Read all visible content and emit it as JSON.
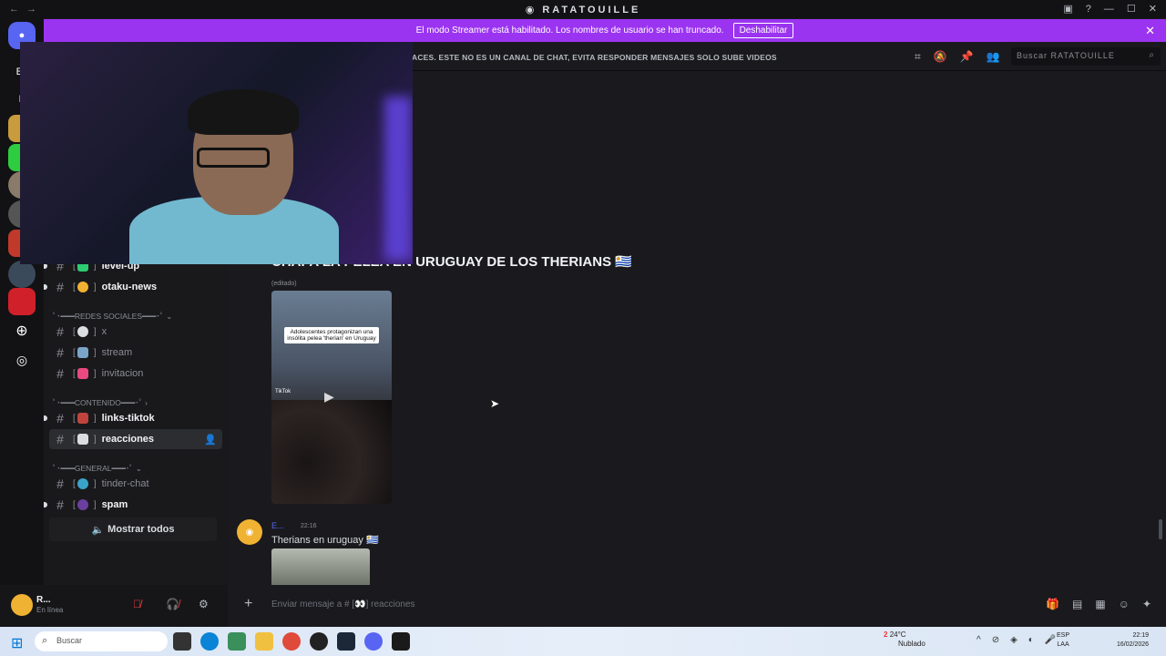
{
  "titlebar": {
    "back": "←",
    "forward": "→",
    "title": "RATATOUILLE"
  },
  "banner": {
    "text": "El modo Streamer está habilitado. Los nombres de usuario se han truncado.",
    "button": "Deshabilitar",
    "close": "✕"
  },
  "rail": {
    "server_initials": [
      "Es",
      "F"
    ]
  },
  "topbar": {
    "topic": "ACES. ESTE NO ES UN CANAL DE CHAT, EVITA RESPONDER MENSAJES SOLO SUBE VIDEOS",
    "search_placeholder": "Buscar RATATOUILLE"
  },
  "sidebar": {
    "channels": [
      {
        "name": "level-up",
        "bracket_open": "[",
        "bracket_close": "]"
      },
      {
        "name": "otaku-news",
        "bracket_open": "[",
        "bracket_close": "]"
      },
      {
        "name": "x",
        "bracket_open": "[",
        "bracket_close": "]"
      },
      {
        "name": "stream",
        "bracket_open": "[",
        "bracket_close": "]"
      },
      {
        "name": "invitacion",
        "bracket_open": "[",
        "bracket_close": "]"
      },
      {
        "name": "links-tiktok",
        "bracket_open": "[",
        "bracket_close": "]"
      },
      {
        "name": "reacciones",
        "bracket_open": "[",
        "bracket_close": "]"
      },
      {
        "name": "tinder-chat",
        "bracket_open": "[",
        "bracket_close": "]"
      },
      {
        "name": "spam",
        "bracket_open": "[",
        "bracket_close": "]"
      }
    ],
    "categories": [
      "ﾟ･━━━REDES SOCIALES━━━･ﾟ ⌄",
      "ﾟ･━━━CONTENIDO━━━･ﾟ ›",
      "ﾟ･━━━GENERAL━━━･ﾟ ⌄"
    ],
    "show_all": "Mostrar todos"
  },
  "user": {
    "name": "R...",
    "status": "En línea"
  },
  "messages": {
    "title": "CHAPA LA PELEA EN URUGUAY DE LOS THERIANS",
    "edited": "(editado)",
    "video_overlay": "Adolescentes protagonizan una insólita pelea 'therian' en Uruguay",
    "video_tiktok": "TikTok",
    "msg2_user": "E...",
    "msg2_time": "22:16",
    "msg2_text": "Therians en uruguay"
  },
  "composer": {
    "placeholder": "Enviar mensaje a # [👀] reacciones"
  },
  "taskbar": {
    "search_placeholder": "Buscar",
    "temp": "24°C",
    "weather": "Nublado",
    "lang1": "ESP",
    "lang2": "LAA",
    "time": "22:19",
    "date": "16/02/2026",
    "badge": "2"
  },
  "colors": {
    "banner": "#9b34f0",
    "avatar": "#f0b232",
    "username_link": "#5865f2",
    "mute_red": "#f23f43"
  }
}
